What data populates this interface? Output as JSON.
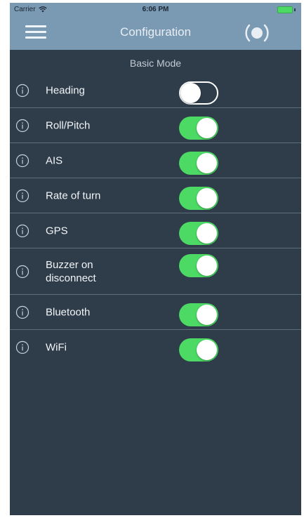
{
  "status_bar": {
    "carrier": "Carrier",
    "time": "6:06 PM",
    "wifi_icon": "wifi-icon",
    "battery_icon": "battery-icon"
  },
  "nav": {
    "title": "Configuration",
    "menu_icon": "hamburger-menu-icon",
    "device_icon": "device-signal-icon"
  },
  "mode_label": "Basic Mode",
  "colors": {
    "header": "#7a99b3",
    "background": "#2f3d4a",
    "toggle_on": "#4cd964",
    "divider": "#5d6e7c"
  },
  "settings": [
    {
      "label": "Heading",
      "enabled": false
    },
    {
      "label": "Roll/Pitch",
      "enabled": true
    },
    {
      "label": "AIS",
      "enabled": true
    },
    {
      "label": "Rate of turn",
      "enabled": true
    },
    {
      "label": "GPS",
      "enabled": true
    },
    {
      "label": "Buzzer on disconnect",
      "enabled": true
    },
    {
      "label": "Bluetooth",
      "enabled": true
    },
    {
      "label": "WiFi",
      "enabled": true
    }
  ]
}
